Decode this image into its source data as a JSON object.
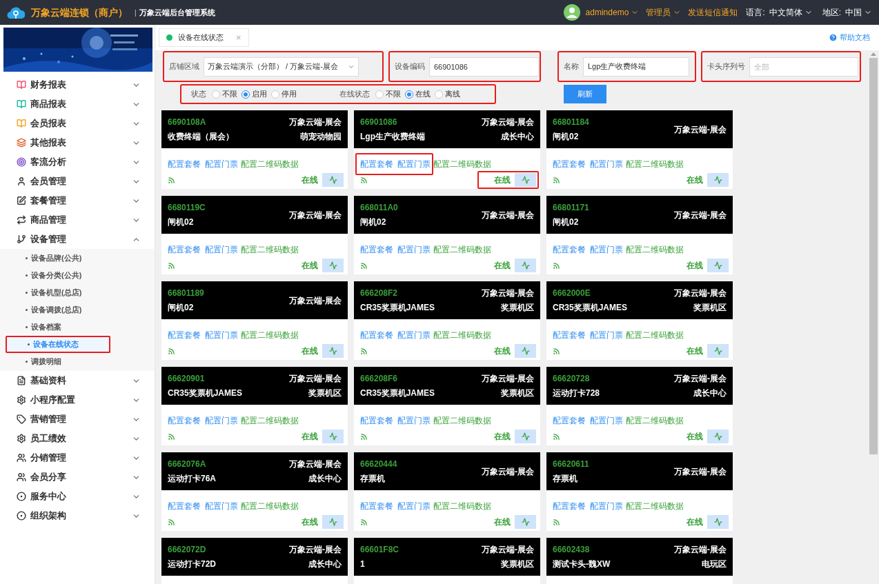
{
  "header": {
    "brand": "万象云端连锁（商户）",
    "separator": "|",
    "system": "万象云端后台管理系统",
    "user": "admindemo",
    "role": "管理员",
    "sms": "发送短信通知",
    "language_label": "语言:",
    "language": "中文简体",
    "region_label": "地区:",
    "region": "中国"
  },
  "sidebar": {
    "items": [
      {
        "label": "财务报表",
        "expanded": false
      },
      {
        "label": "商品报表",
        "expanded": false
      },
      {
        "label": "会员报表",
        "expanded": false
      },
      {
        "label": "其他报表",
        "expanded": false
      },
      {
        "label": "客流分析",
        "expanded": false
      },
      {
        "label": "会员管理",
        "expanded": false
      },
      {
        "label": "套餐管理",
        "expanded": false
      },
      {
        "label": "商品管理",
        "expanded": false
      },
      {
        "label": "设备管理",
        "expanded": true,
        "children": [
          {
            "label": "设备品牌(公共)",
            "selected": false,
            "highlighted": false
          },
          {
            "label": "设备分类(公共)",
            "selected": false,
            "highlighted": false
          },
          {
            "label": "设备机型(总店)",
            "selected": false,
            "highlighted": false
          },
          {
            "label": "设备调拨(总店)",
            "selected": false,
            "highlighted": false
          },
          {
            "label": "设备档案",
            "selected": false,
            "highlighted": false
          },
          {
            "label": "设备在线状态",
            "selected": true,
            "highlighted": true
          },
          {
            "label": "调拨明细",
            "selected": false,
            "highlighted": false
          }
        ]
      },
      {
        "label": "基础资料",
        "expanded": false
      },
      {
        "label": "小程序配置",
        "expanded": false
      },
      {
        "label": "营销管理",
        "expanded": false
      },
      {
        "label": "员工绩效",
        "expanded": false
      },
      {
        "label": "分销管理",
        "expanded": false
      },
      {
        "label": "会员分享",
        "expanded": false
      },
      {
        "label": "服务中心",
        "expanded": false
      },
      {
        "label": "组织架构",
        "expanded": false
      }
    ]
  },
  "tab": {
    "label": "设备在线状态",
    "close": "×"
  },
  "help": "帮助文档",
  "filters": {
    "fields": [
      {
        "kind": "select",
        "label": "店铺区域",
        "value": "万象云端演示（分部） / 万象云端-展会",
        "highlighted": true
      },
      {
        "kind": "input",
        "label": "设备编码",
        "value": "66901086",
        "highlighted": true
      },
      {
        "kind": "input",
        "label": "名称",
        "value": "Lgp生产收费终端",
        "highlighted": true
      },
      {
        "kind": "input",
        "label": "卡头序列号",
        "placeholder": "全部",
        "highlighted": true
      }
    ],
    "radio_groups": [
      {
        "label": "状态",
        "options": [
          {
            "label": "不限",
            "selected": false
          },
          {
            "label": "启用",
            "selected": true
          },
          {
            "label": "停用",
            "selected": false
          }
        ]
      },
      {
        "label": "在线状态",
        "options": [
          {
            "label": "不限",
            "selected": false
          },
          {
            "label": "在线",
            "selected": true
          },
          {
            "label": "离线",
            "selected": false
          }
        ]
      }
    ],
    "radios_highlighted": true,
    "refresh": "刷新"
  },
  "cards": [
    {
      "code": "6690108A",
      "store": "万象云端-展会",
      "name": "收费终端（展会）",
      "area": "萌宠动物园",
      "links": [
        "配置套餐",
        "配置门票",
        "配置二维码数据"
      ],
      "status": "在线",
      "online": true,
      "highlight_links": false,
      "highlight_status": false
    },
    {
      "code": "66901086",
      "store": "万象云端-展会",
      "name": "Lgp生产收费终端",
      "area": "成长中心",
      "links": [
        "配置套餐",
        "配置门票",
        "配置二维码数据"
      ],
      "status": "在线",
      "online": true,
      "highlight_links": true,
      "highlight_status": true
    },
    {
      "code": "66801184",
      "store": "万象云端-展会",
      "name": "闸机02",
      "links": [
        "配置套餐",
        "配置门票",
        "配置二维码数据"
      ],
      "status": "在线",
      "online": true,
      "highlight_links": false,
      "highlight_status": false
    },
    {
      "code": "6680119C",
      "store": "万象云端-展会",
      "name": "闸机02",
      "links": [
        "配置套餐",
        "配置门票",
        "配置二维码数据"
      ],
      "status": "在线",
      "online": true,
      "highlight_links": false,
      "highlight_status": false
    },
    {
      "code": "668011A0",
      "store": "万象云端-展会",
      "name": "闸机02",
      "links": [
        "配置套餐",
        "配置门票",
        "配置二维码数据"
      ],
      "status": "在线",
      "online": true,
      "highlight_links": false,
      "highlight_status": false
    },
    {
      "code": "66801171",
      "store": "万象云端-展会",
      "name": "闸机02",
      "links": [
        "配置套餐",
        "配置门票",
        "配置二维码数据"
      ],
      "status": "在线",
      "online": true,
      "highlight_links": false,
      "highlight_status": false
    },
    {
      "code": "66801189",
      "store": "万象云端-展会",
      "name": "闸机02",
      "links": [
        "配置套餐",
        "配置门票",
        "配置二维码数据"
      ],
      "status": "在线",
      "online": true,
      "highlight_links": false,
      "highlight_status": false
    },
    {
      "code": "666208F2",
      "store": "万象云端-展会",
      "name": "CR35奖票机JAMES",
      "area": "奖票机区",
      "links": [
        "配置套餐",
        "配置门票",
        "配置二维码数据"
      ],
      "status": "在线",
      "online": true,
      "highlight_links": false,
      "highlight_status": false
    },
    {
      "code": "6662000E",
      "store": "万象云端-展会",
      "name": "CR35奖票机JAMES",
      "area": "奖票机区",
      "links": [
        "配置套餐",
        "配置门票",
        "配置二维码数据"
      ],
      "status": "在线",
      "online": true,
      "highlight_links": false,
      "highlight_status": false
    },
    {
      "code": "66620901",
      "store": "万象云端-展会",
      "name": "CR35奖票机JAMES",
      "area": "奖票机区",
      "links": [
        "配置套餐",
        "配置门票",
        "配置二维码数据"
      ],
      "status": "在线",
      "online": true,
      "highlight_links": false,
      "highlight_status": false
    },
    {
      "code": "666208F6",
      "store": "万象云端-展会",
      "name": "CR35奖票机JAMES",
      "area": "奖票机区",
      "links": [
        "配置套餐",
        "配置门票",
        "配置二维码数据"
      ],
      "status": "在线",
      "online": true,
      "highlight_links": false,
      "highlight_status": false
    },
    {
      "code": "66620728",
      "store": "万象云端-展会",
      "name": "运动打卡728",
      "area": "成长中心",
      "links": [
        "配置套餐",
        "配置门票",
        "配置二维码数据"
      ],
      "status": "在线",
      "online": true,
      "highlight_links": false,
      "highlight_status": false
    },
    {
      "code": "6662076A",
      "store": "万象云端-展会",
      "name": "运动打卡76A",
      "area": "成长中心",
      "links": [
        "配置套餐",
        "配置门票",
        "配置二维码数据"
      ],
      "status": "在线",
      "online": true,
      "highlight_links": false,
      "highlight_status": false
    },
    {
      "code": "66620444",
      "store": "万象云端-展会",
      "name": "存票机",
      "links": [
        "配置套餐",
        "配置门票",
        "配置二维码数据"
      ],
      "status": "在线",
      "online": true,
      "highlight_links": false,
      "highlight_status": false
    },
    {
      "code": "66620611",
      "store": "万象云端-展会",
      "name": "存票机",
      "links": [
        "配置套餐",
        "配置门票",
        "配置二维码数据"
      ],
      "status": "在线",
      "online": true,
      "highlight_links": false,
      "highlight_status": false
    },
    {
      "code": "6662072D",
      "store": "万象云端-展会",
      "name": "运动打卡72D",
      "area": "成长中心"
    },
    {
      "code": "66601F8C",
      "store": "万象云端-展会",
      "name": "1",
      "area": "奖票机区"
    },
    {
      "code": "66602438",
      "store": "万象云端-展会",
      "name": "测试卡头-魏XW",
      "area": "电玩区"
    }
  ]
}
